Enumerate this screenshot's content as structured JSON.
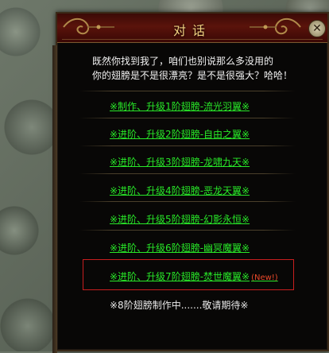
{
  "dialog": {
    "title": "对话",
    "close_label": "✕",
    "intro_lines": [
      "既然你找到我了，咱们也别说那么多没用的",
      "你的翅膀是不是很漂亮？是不是很强大？哈哈！"
    ],
    "options": [
      {
        "label": "※制作、升级1阶翅膀-流光羽翼※"
      },
      {
        "label": "※进阶、升级2阶翅膀-自由之翼※"
      },
      {
        "label": "※进阶、升级3阶翅膀-龙啸九天※"
      },
      {
        "label": "※进阶、升级4阶翅膀-恶龙天翼※"
      },
      {
        "label": "※进阶、升级5阶翅膀-幻影永恒※"
      },
      {
        "label": "※进阶、升级6阶翅膀-幽冥魔翼※"
      },
      {
        "label": "※进阶、升级7阶翅膀-焚世魔翼※",
        "badge": "(New!)"
      }
    ],
    "footer": "※8阶翅膀制作中.......敬请期待※"
  },
  "colors": {
    "option_text": "#28e828",
    "new_badge": "#e84a2a",
    "title_text": "#f0d080",
    "highlight_border": "#c81e1e"
  }
}
